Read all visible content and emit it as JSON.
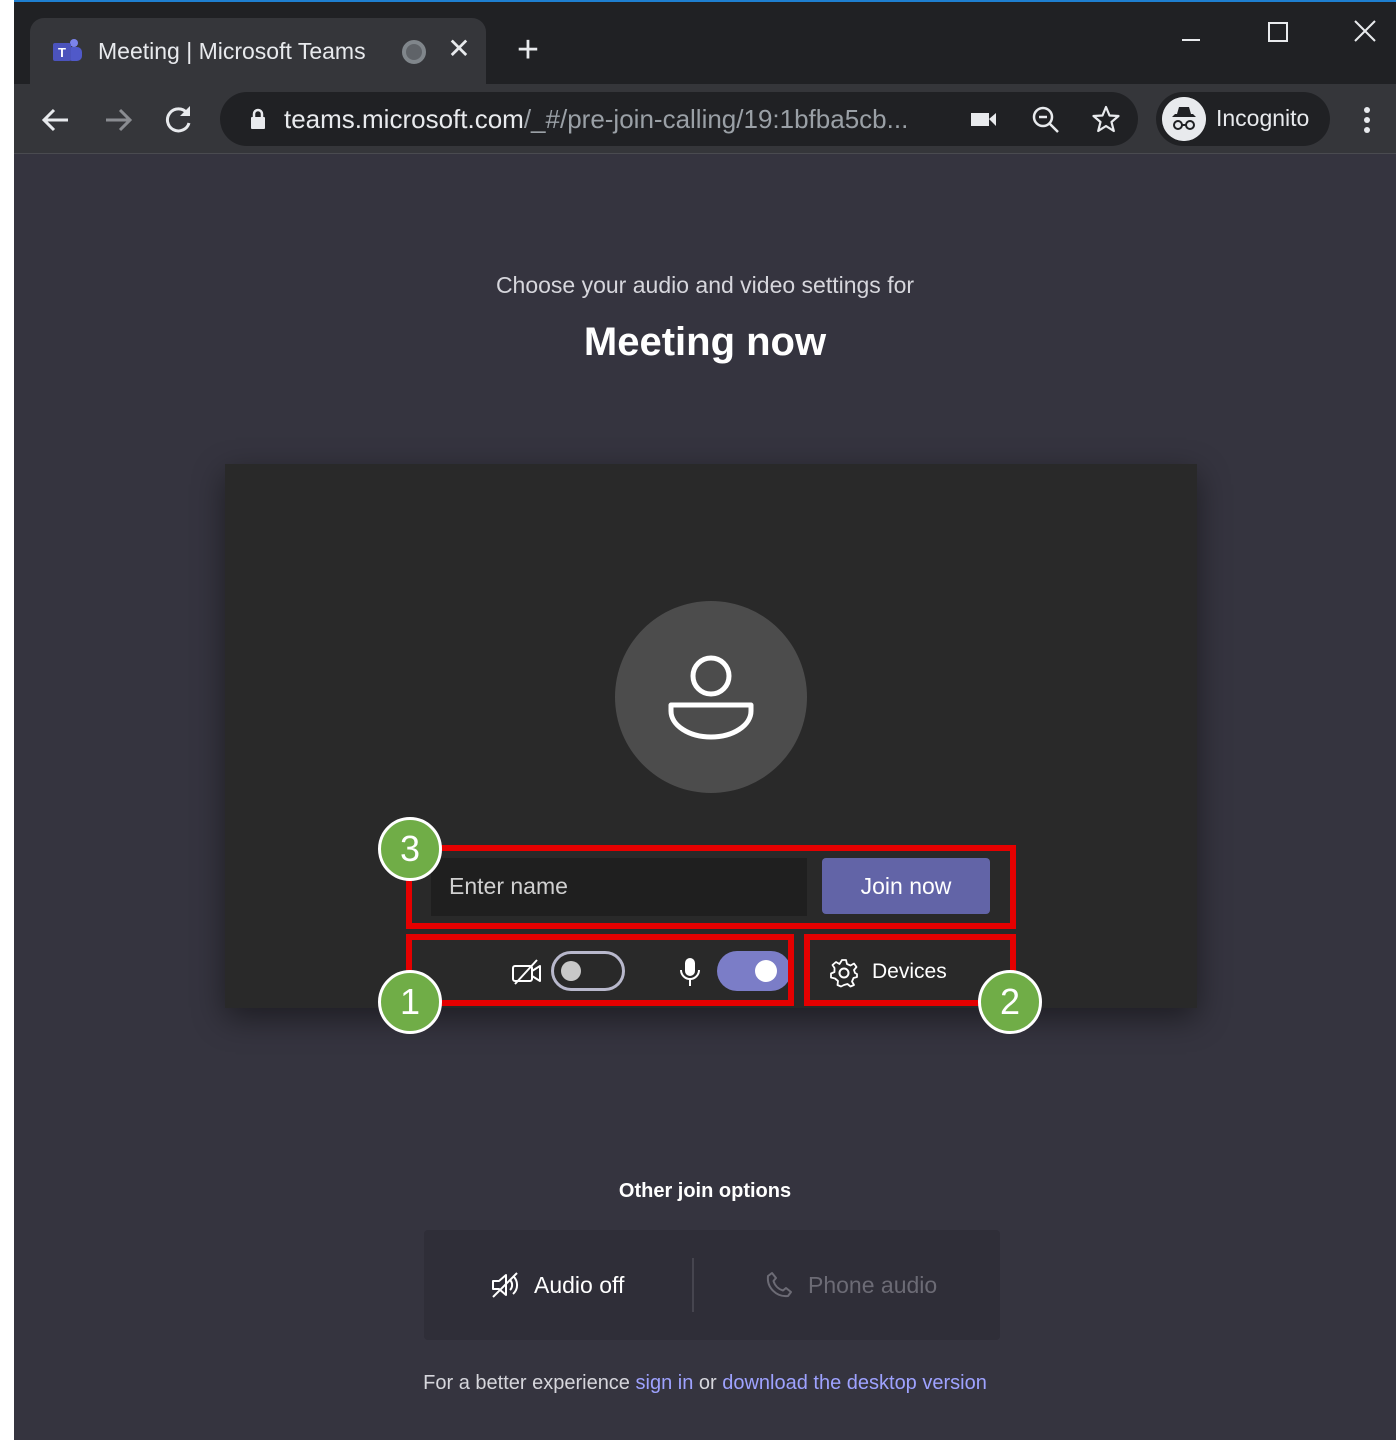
{
  "browser": {
    "tab_title": "Meeting | Microsoft Teams",
    "tab_close": "✕",
    "new_tab": "+",
    "url_host": "teams.microsoft.com",
    "url_path": "/_#/pre-join-calling/19:1bfba5cb...",
    "profile_label": "Incognito"
  },
  "header": {
    "subtitle": "Choose your audio and video settings for",
    "title": "Meeting now"
  },
  "prejoin": {
    "name_placeholder": "Enter name",
    "join_label": "Join now",
    "camera_enabled": false,
    "mic_enabled": true,
    "devices_label": "Devices"
  },
  "annotations": {
    "badge_1": "1",
    "badge_2": "2",
    "badge_3": "3"
  },
  "other_options": {
    "heading": "Other join options",
    "audio_off": "Audio off",
    "phone_audio": "Phone audio"
  },
  "footer": {
    "prefix": "For a better experience ",
    "sign_in": "sign in",
    "middle": " or ",
    "download": "download the desktop version"
  },
  "colors": {
    "page_bg": "#35343f",
    "accent": "#6264a7",
    "annotation_red": "#e50000",
    "badge_green": "#70ad47"
  }
}
